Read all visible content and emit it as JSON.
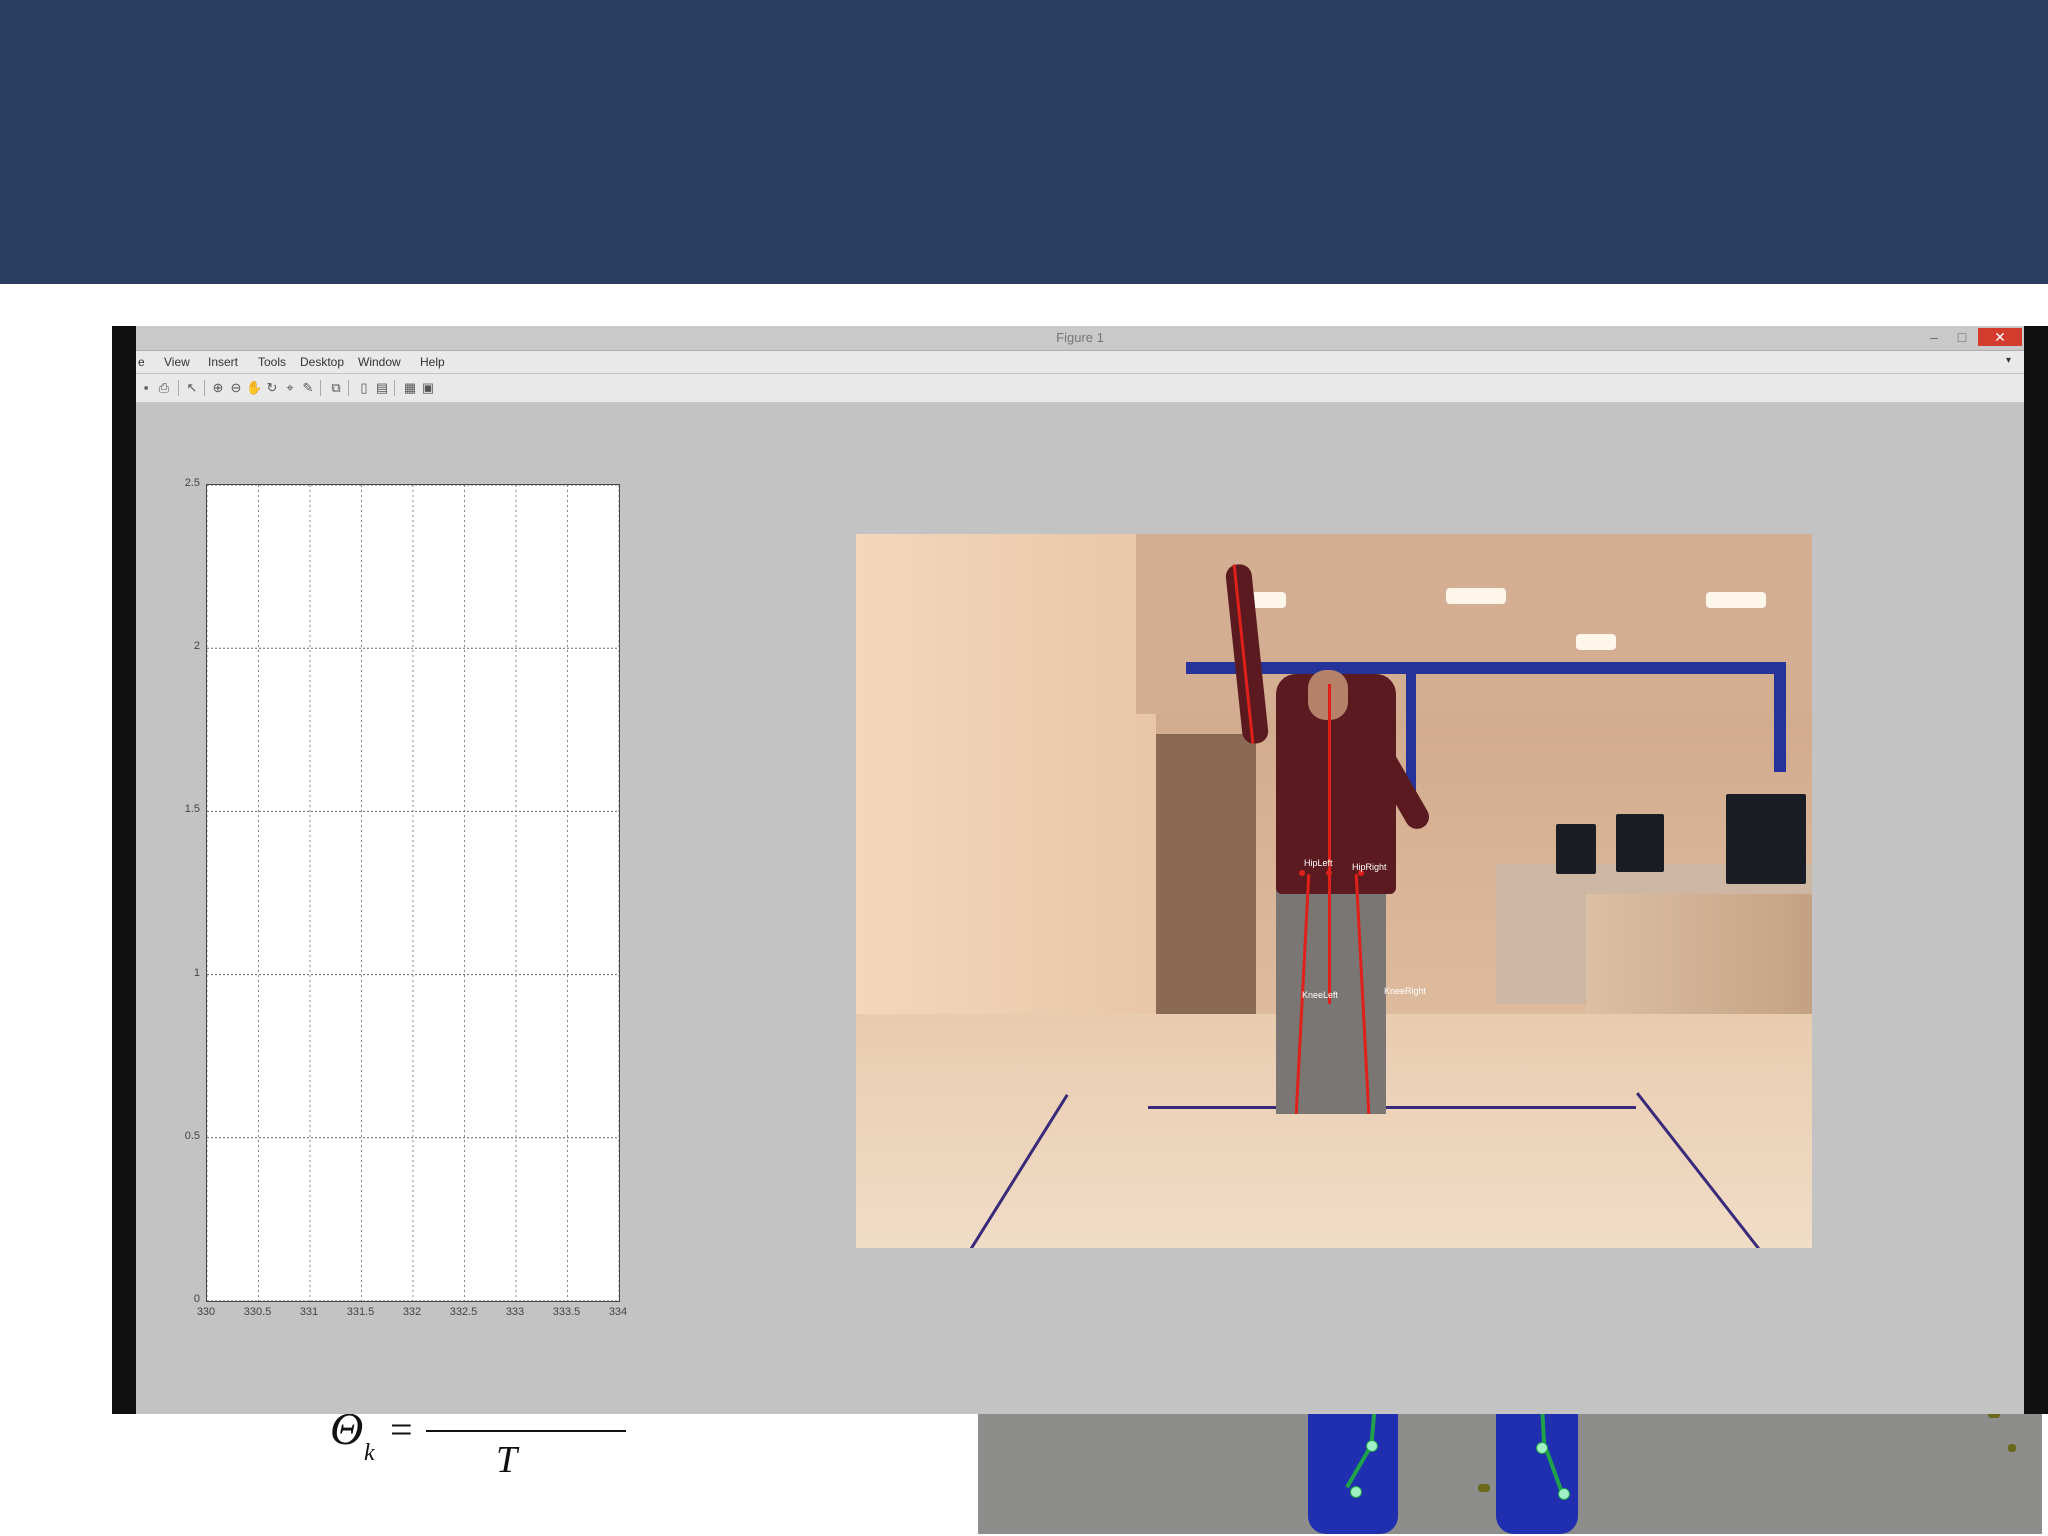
{
  "window": {
    "title": "Figure 1",
    "controls": {
      "minimize": "–",
      "maximize": "□",
      "close": "✕"
    }
  },
  "menu": {
    "items": [
      {
        "key": "file",
        "label": "e"
      },
      {
        "key": "view",
        "label": "View"
      },
      {
        "key": "insert",
        "label": "Insert"
      },
      {
        "key": "tools",
        "label": "Tools"
      },
      {
        "key": "desktop",
        "label": "Desktop"
      },
      {
        "key": "window",
        "label": "Window"
      },
      {
        "key": "help",
        "label": "Help"
      }
    ],
    "overflow_icon": "down-arrow-icon"
  },
  "toolbar": {
    "icons": [
      "save-icon",
      "print-icon",
      "select-arrow-icon",
      "zoom-in-icon",
      "zoom-out-icon",
      "pan-icon",
      "rotate-3d-icon",
      "data-cursor-icon",
      "brush-icon",
      "link-plot-icon",
      "colorbar-icon",
      "legend-icon",
      "hide-plot-tools-icon",
      "show-plot-tools-icon"
    ]
  },
  "chart_data": {
    "type": "line",
    "title": "",
    "xlabel": "",
    "ylabel": "",
    "xlim": [
      330,
      334
    ],
    "ylim": [
      0,
      2.5
    ],
    "x_ticks": [
      "330",
      "330.5",
      "331",
      "331.5",
      "332",
      "332.5",
      "333",
      "333.5",
      "334"
    ],
    "y_ticks": [
      "0",
      "0.5",
      "1",
      "1.5",
      "2",
      "2.5"
    ],
    "grid": true,
    "series": []
  },
  "camera": {
    "joint_labels": [
      "HipLeft",
      "HipRight",
      "KneeLeft",
      "KneeRight"
    ]
  },
  "slide": {
    "formula": {
      "symbol": "Θ",
      "subscript": "k",
      "equals": "=",
      "denominator": "T"
    }
  }
}
